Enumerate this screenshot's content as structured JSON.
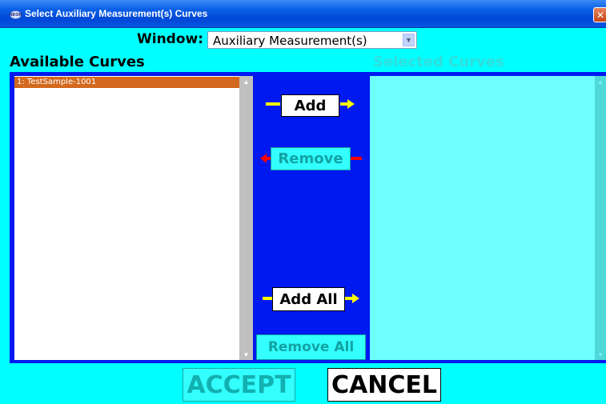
{
  "window": {
    "title": "Select Auxiliary Measurement(s) Curves",
    "close_glyph": "✕",
    "app_icon_text": "NEON"
  },
  "window_selector": {
    "label": "Window:",
    "value": "Auxiliary Measurement(s)"
  },
  "available": {
    "label": "Available Curves",
    "items": [
      "1: TestSample-1001"
    ],
    "selected_index": 0
  },
  "selected": {
    "label": "Selected Curves",
    "items": []
  },
  "buttons": {
    "add": "Add",
    "remove": "Remove",
    "add_all": "Add All",
    "remove_all": "Remove All",
    "accept": "ACCEPT",
    "cancel": "CANCEL"
  },
  "colors": {
    "dialog_bg": "#00ffff",
    "panel_blue": "#0019f0",
    "selected_item": "#d2691e",
    "arrow_yellow": "#ffff00",
    "arrow_red": "#ff0000",
    "disabled_text": "#12a3a3"
  },
  "icons": {
    "scroll_up": "scroll-up-icon",
    "scroll_down": "scroll-down-icon",
    "dropdown": "chevron-down-icon"
  }
}
